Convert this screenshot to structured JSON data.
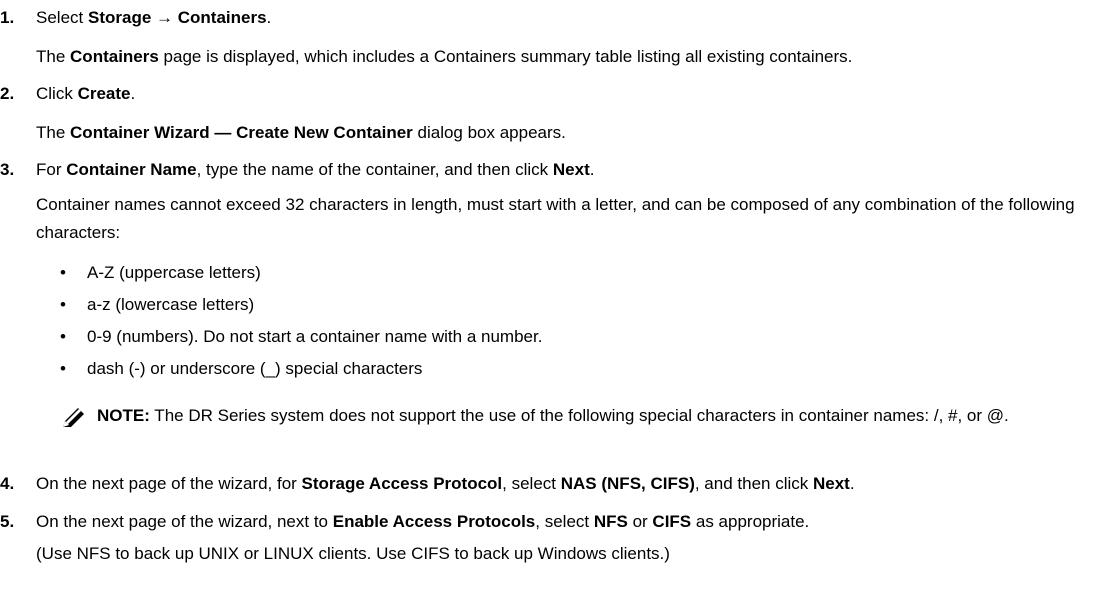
{
  "steps": [
    {
      "num": "1.",
      "pre": "Select ",
      "b1": "Storage",
      "mid": " → ",
      "b2": "Containers",
      "post": "."
    },
    {
      "num": "2.",
      "pre": "Click ",
      "b1": "Create",
      "post": "."
    },
    {
      "num": "3.",
      "pre": "For ",
      "b1": "Container Name",
      "mid": ", type the name of the container, and then click ",
      "b2": "Next",
      "post": "."
    },
    {
      "num": "4.",
      "pre": "On the next page of the wizard, for ",
      "b1": "Storage Access Protocol",
      "mid": ", select ",
      "b2": "NAS (NFS, CIFS)",
      "mid2": ", and then click ",
      "b3": "Next",
      "post": "."
    },
    {
      "num": "5.",
      "pre": "On the next page of the wizard, next to ",
      "b1": "Enable Access Protocols",
      "mid": ", select ",
      "b2": "NFS",
      "mid2": " or ",
      "b3": "CIFS",
      "post": " as appropriate."
    }
  ],
  "sub1": {
    "pre": "The ",
    "bold": "Containers",
    "post": " page is displayed, which includes a Containers summary table listing all existing containers."
  },
  "sub2": {
    "pre": "The ",
    "bold": "Container Wizard — Create New Container",
    "post": " dialog box appears."
  },
  "sub3": "Container names cannot exceed 32 characters in length, must start with a letter, and can be composed of any combination of the following characters:",
  "bullets": [
    "A-Z (uppercase letters)",
    "a-z (lowercase letters)",
    "0-9 (numbers). Do not start a container name with a number.",
    "dash (-) or underscore (_) special characters"
  ],
  "bullet_char": "•",
  "note": {
    "label": "NOTE:",
    "text": " The DR Series system does not support the use of the following special characters in container names: /, #, or @."
  },
  "sub5": "(Use NFS to back up UNIX or LINUX clients. Use CIFS to back up Windows clients.)"
}
